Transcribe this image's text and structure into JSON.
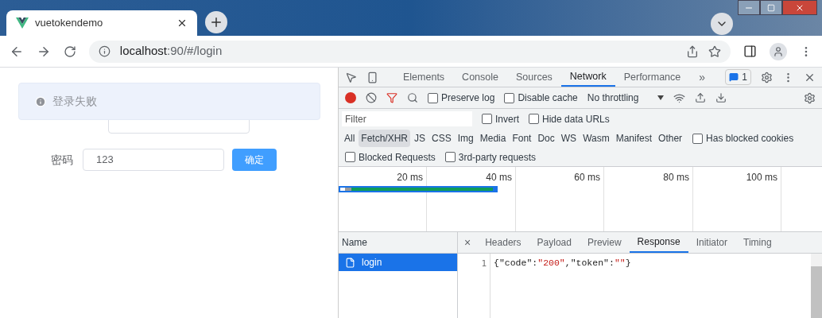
{
  "browser_tab": {
    "title": "vuetokendemo",
    "selected": true
  },
  "address": {
    "host": "localhost",
    "rest": ":90/#/login"
  },
  "page": {
    "alert": "登录失败",
    "fields": [
      {
        "label": "密码",
        "value": "123"
      }
    ],
    "submit": "确定"
  },
  "devtools": {
    "tabs": [
      {
        "label": "Elements",
        "selected": false
      },
      {
        "label": "Console",
        "selected": false
      },
      {
        "label": "Sources",
        "selected": false
      },
      {
        "label": "Network",
        "selected": true
      },
      {
        "label": "Performance",
        "selected": false
      }
    ],
    "more": "»",
    "issues": "1",
    "options": [
      {
        "label": "Preserve log",
        "checked": false
      },
      {
        "label": "Disable cache",
        "checked": false
      }
    ],
    "throttling": "No throttling",
    "filter": {
      "placeholder": "Filter"
    },
    "filter_options": [
      {
        "label": "Invert",
        "checked": false
      },
      {
        "label": "Hide data URLs",
        "checked": false
      }
    ],
    "types": [
      {
        "label": "All",
        "selected": false
      },
      {
        "label": "Fetch/XHR",
        "selected": true
      },
      {
        "label": "JS",
        "selected": false
      },
      {
        "label": "CSS",
        "selected": false
      },
      {
        "label": "Img",
        "selected": false
      },
      {
        "label": "Media",
        "selected": false
      },
      {
        "label": "Font",
        "selected": false
      },
      {
        "label": "Doc",
        "selected": false
      },
      {
        "label": "WS",
        "selected": false
      },
      {
        "label": "Wasm",
        "selected": false
      },
      {
        "label": "Manifest",
        "selected": false
      },
      {
        "label": "Other",
        "selected": false
      }
    ],
    "type_options": [
      {
        "label": "Has blocked cookies",
        "checked": false
      }
    ],
    "request_options": [
      {
        "label": "Blocked Requests",
        "checked": false
      },
      {
        "label": "3rd-party requests",
        "checked": false
      }
    ],
    "ticks": [
      "20 ms",
      "40 ms",
      "60 ms",
      "80 ms",
      "100 ms"
    ],
    "name_header": "Name",
    "requests": [
      {
        "name": "login",
        "selected": true
      }
    ],
    "detail_close": "×",
    "detail_tabs": [
      {
        "label": "Headers",
        "selected": false
      },
      {
        "label": "Payload",
        "selected": false
      },
      {
        "label": "Preview",
        "selected": false
      },
      {
        "label": "Response",
        "selected": true
      },
      {
        "label": "Initiator",
        "selected": false
      },
      {
        "label": "Timing",
        "selected": false
      }
    ],
    "response": {
      "line_number": "1",
      "tokens": [
        {
          "kind": "punct",
          "text": "{"
        },
        {
          "kind": "key",
          "text": "\"code\""
        },
        {
          "kind": "punct",
          "text": ":"
        },
        {
          "kind": "string",
          "text": "\"200\""
        },
        {
          "kind": "punct",
          "text": ","
        },
        {
          "kind": "key",
          "text": "\"token\""
        },
        {
          "kind": "punct",
          "text": ":"
        },
        {
          "kind": "string",
          "text": "\"\""
        },
        {
          "kind": "punct",
          "text": "}"
        }
      ]
    }
  }
}
